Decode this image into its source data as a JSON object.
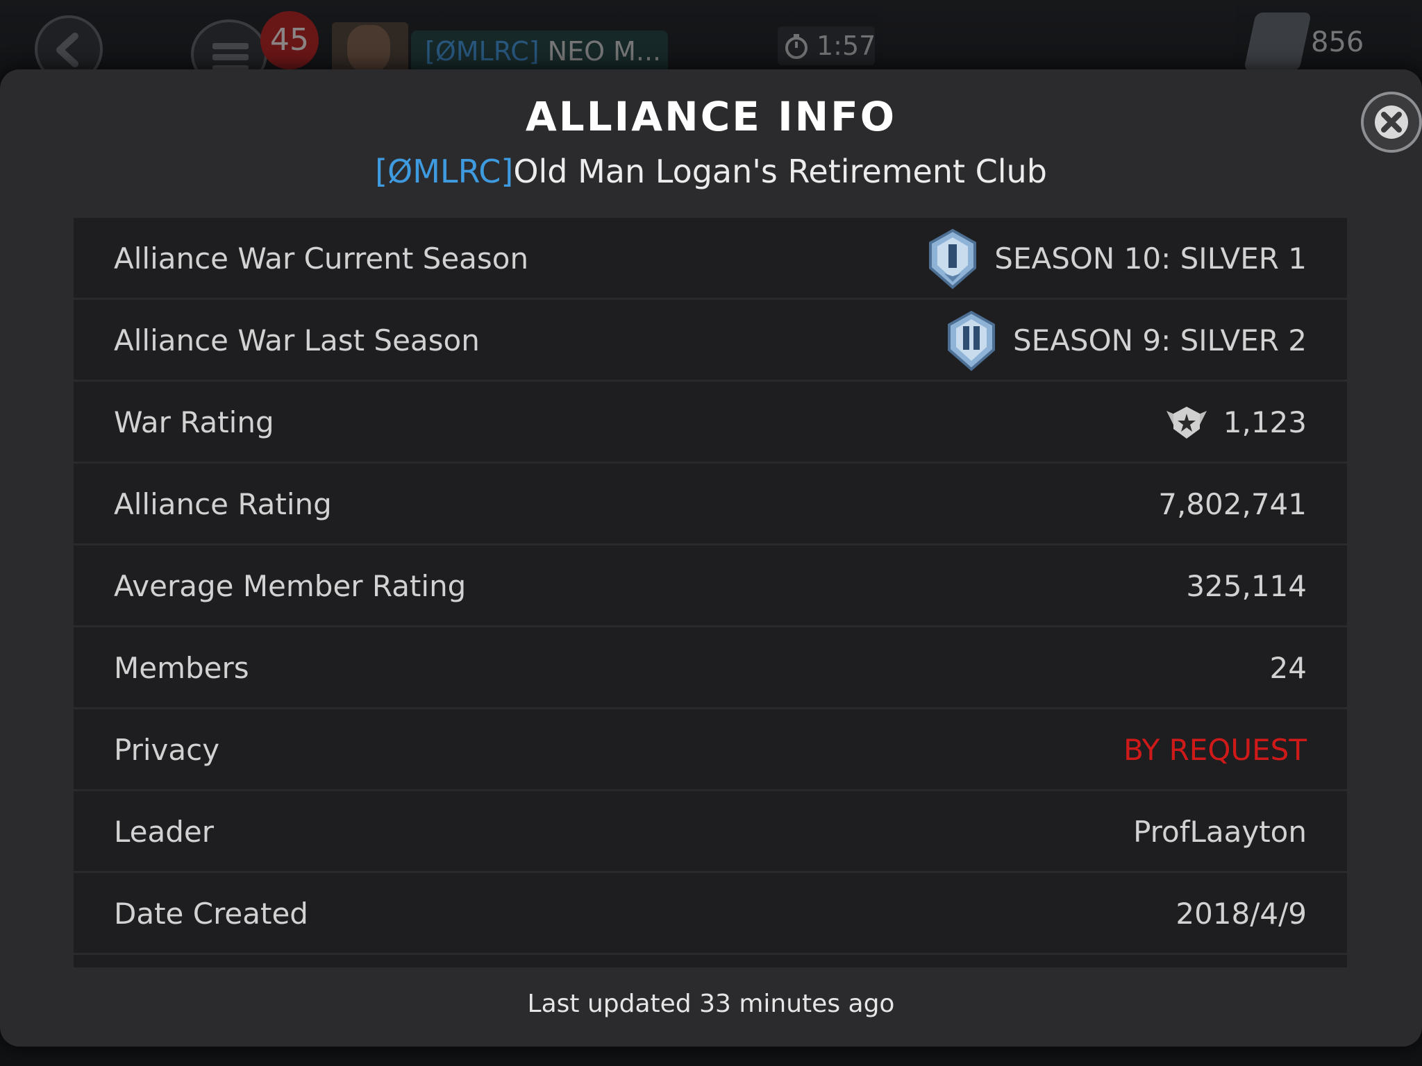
{
  "topbar": {
    "notification_count": "45",
    "alliance_tag": "[ØMLRC]",
    "alliance_short": "NEO M...",
    "timer": "1:57",
    "units": "856"
  },
  "dialog": {
    "title": "ALLIANCE INFO",
    "alliance_tag": "[ØMLRC]",
    "alliance_name": "Old Man Logan's Retirement Club",
    "rows": [
      {
        "label": "Alliance War Current Season",
        "value": "SEASON 10: SILVER 1",
        "icon": "silver-season-badge-icon"
      },
      {
        "label": "Alliance War Last Season",
        "value": "SEASON 9: SILVER 2",
        "icon": "silver-season-badge-icon"
      },
      {
        "label": "War Rating",
        "value": "1,123",
        "icon": "war-rating-emblem-icon"
      },
      {
        "label": "Alliance Rating",
        "value": "7,802,741"
      },
      {
        "label": "Average Member Rating",
        "value": "325,114"
      },
      {
        "label": "Members",
        "value": "24"
      },
      {
        "label": "Privacy",
        "value": "BY REQUEST",
        "value_color": "#d01a1a"
      },
      {
        "label": "Leader",
        "value": "ProfLaayton"
      },
      {
        "label": "Date Created",
        "value": "2018/4/9"
      }
    ],
    "footer": "Last updated 33 minutes ago"
  },
  "colors": {
    "panel_bg": "#2b2b2d",
    "table_bg": "#1e1e20",
    "tag_blue": "#3f9be0",
    "privacy_red": "#d01a1a"
  }
}
